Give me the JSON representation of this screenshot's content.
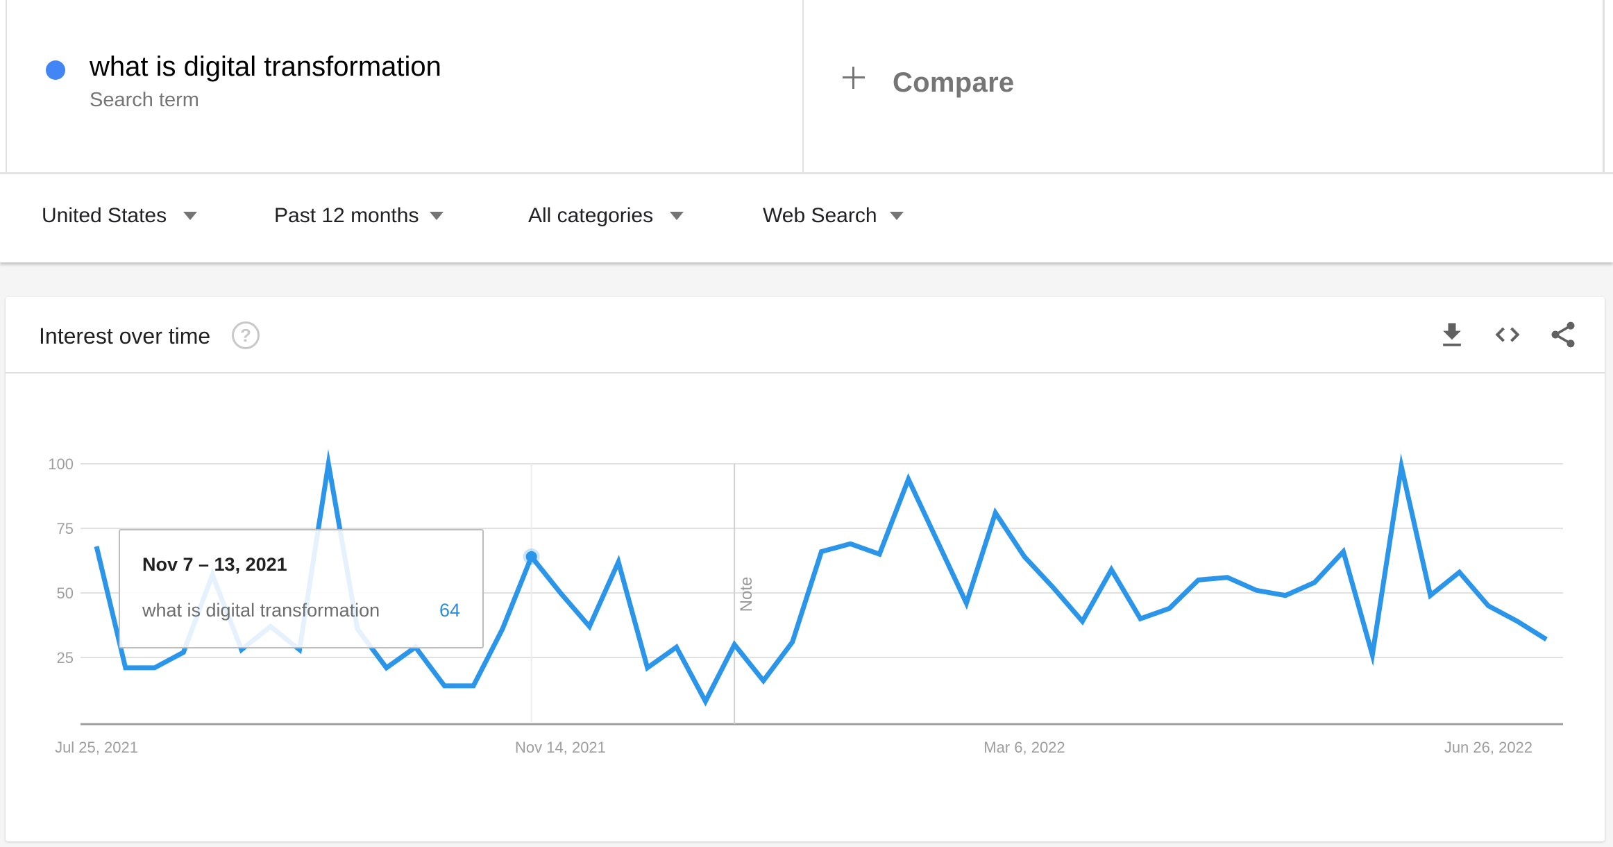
{
  "search_term": {
    "label": "what is digital transformation",
    "sublabel": "Search term",
    "color": "#4285f4"
  },
  "compare": {
    "icon": "plus-icon",
    "label": "Compare"
  },
  "filters": [
    {
      "label": "United States",
      "icon": "caret-down-icon"
    },
    {
      "label": "Past 12 months",
      "icon": "caret-down-icon"
    },
    {
      "label": "All categories",
      "icon": "caret-down-icon"
    },
    {
      "label": "Web Search",
      "icon": "caret-down-icon"
    }
  ],
  "card": {
    "title": "Interest over time",
    "help_icon": "question-circle-icon",
    "help_glyph": "?",
    "actions": [
      {
        "name": "download-button",
        "icon": "download-icon"
      },
      {
        "name": "embed-button",
        "icon": "code-icon"
      },
      {
        "name": "share-button",
        "icon": "share-icon"
      }
    ]
  },
  "tooltip": {
    "date": "Nov 7 – 13, 2021",
    "term": "what is digital transformation",
    "value": "64"
  },
  "chart_data": {
    "type": "line",
    "title": "Interest over time",
    "xlabel": "",
    "ylabel": "",
    "ylim": [
      0,
      100
    ],
    "yticks": [
      25,
      50,
      75,
      100
    ],
    "grid": true,
    "x_tick_labels": [
      {
        "index": 0,
        "label": "Jul 25, 2021"
      },
      {
        "index": 16,
        "label": "Nov 14, 2021"
      },
      {
        "index": 32,
        "label": "Mar 6, 2022"
      },
      {
        "index": 48,
        "label": "Jun 26, 2022"
      }
    ],
    "x_start": "Jul 25, 2021",
    "x_interval": "weekly",
    "annotation": {
      "index": 22,
      "label": "Note"
    },
    "highlight_index": 15,
    "series": [
      {
        "name": "what is digital transformation",
        "color": "#2b95e9",
        "values": [
          68,
          21,
          21,
          27,
          57,
          28,
          37,
          28,
          100,
          36,
          21,
          29,
          14,
          14,
          36,
          64,
          50,
          37,
          62,
          21,
          29,
          8,
          30,
          16,
          31,
          66,
          69,
          65,
          94,
          70,
          46,
          81,
          64,
          52,
          39,
          59,
          40,
          44,
          55,
          56,
          51,
          49,
          54,
          66,
          26,
          99,
          49,
          58,
          45,
          39,
          32
        ]
      }
    ]
  }
}
